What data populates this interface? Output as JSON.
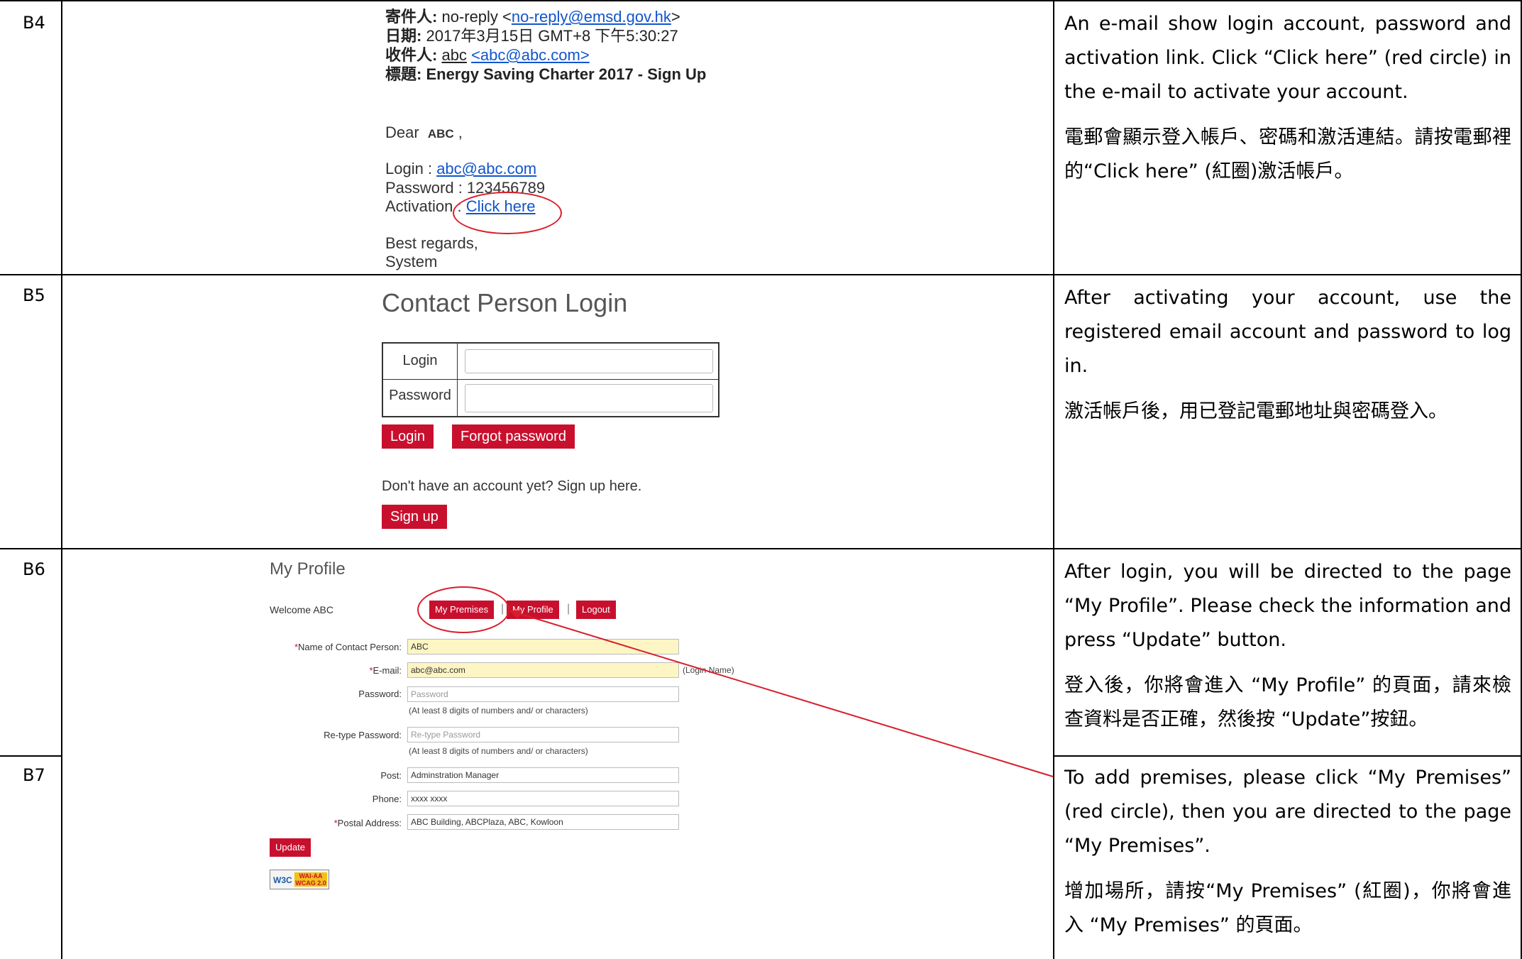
{
  "rows": [
    {
      "id": "B4"
    },
    {
      "id": "B5"
    },
    {
      "id": "B6"
    },
    {
      "id": "B7"
    }
  ],
  "email": {
    "from_label": "寄件人:",
    "from_value": "no-reply <",
    "from_link": "no-reply@emsd.gov.hk",
    "from_end": ">",
    "date_label": "日期:",
    "date_value": "2017年3月15日 GMT+8 下午5:30:27",
    "to_label": "收件人:",
    "to_name": "abc",
    "to_link": "<abc@abc.com>",
    "subject_label": "標題:",
    "subject_value": "Energy Saving Charter 2017 - Sign Up",
    "dear": "Dear",
    "dear_name": "ABC",
    "dear_comma": ",",
    "login_label": "Login :",
    "login_value": "abc@abc.com",
    "password_line": "Password : 123456789",
    "activation_label": "Activation :",
    "activation_link": "Click here",
    "regards": "Best regards,",
    "system": "System"
  },
  "login_page": {
    "title": "Contact Person Login",
    "login_label": "Login",
    "password_label": "Password",
    "login_button": "Login",
    "forgot_button": "Forgot password",
    "signup_note": "Don't have an account yet? Sign up here.",
    "signup_button": "Sign up"
  },
  "profile_page": {
    "title": "My Profile",
    "welcome": "Welcome ABC",
    "nav": {
      "premises": "My Premises",
      "profile": "My Profile",
      "logout": "Logout",
      "sep": "|"
    },
    "fields": {
      "name_label": "Name of Contact Person:",
      "name_value": "ABC",
      "email_label": "E-mail:",
      "email_value": "abc@abc.com",
      "email_note": "(Login Name)",
      "password_label": "Password:",
      "password_placeholder": "Password",
      "password_hint": "(At least 8 digits of numbers and/ or characters)",
      "retype_label": "Re-type Password:",
      "retype_placeholder": "Re-type Password",
      "retype_hint": "(At least 8 digits of numbers and/ or characters)",
      "post_label": "Post:",
      "post_value": "Adminstration Manager",
      "phone_label": "Phone:",
      "phone_value": "xxxx xxxx",
      "address_label": "Postal Address:",
      "address_value": "ABC Building, ABCPlaza, ABC, Kowloon",
      "required_mark": "*"
    },
    "update_button": "Update",
    "badge_w3c": "W3C",
    "badge_level": "WAI-AA",
    "badge_wcag": "WCAG 2.0"
  },
  "descriptions": {
    "b4_en": "An e-mail show login account, password and activation link. Click “Click here” (red circle) in the e-mail to activate your account.",
    "b4_zh": "電郵會顯示登入帳戶、密碼和激活連結。請按電郵裡的“Click here” (紅圈)激活帳戶。",
    "b5_en": "After activating your account, use the registered email account and password to log in.",
    "b5_zh": "激活帳戶後，用已登記電郵地址與密碼登入。",
    "b6_en": "After login, you will be directed to the page “My Profile”. Please check the information and press “Update” button.",
    "b6_zh": "登入後，你將會進入 “My Profile” 的頁面，請來檢查資料是否正確，然後按 “Update”按鈕。",
    "b7_en": "To add premises, please click “My Premises” (red circle), then you are directed to the page “My Premises”.",
    "b7_zh": "增加場所，請按“My Premises” (紅圈)，你將會進入 “My Premises” 的頁面。"
  },
  "colors": {
    "accent_red": "#c8102e",
    "link_blue": "#1155cc",
    "highlight_yellow": "#fdf6c4"
  }
}
